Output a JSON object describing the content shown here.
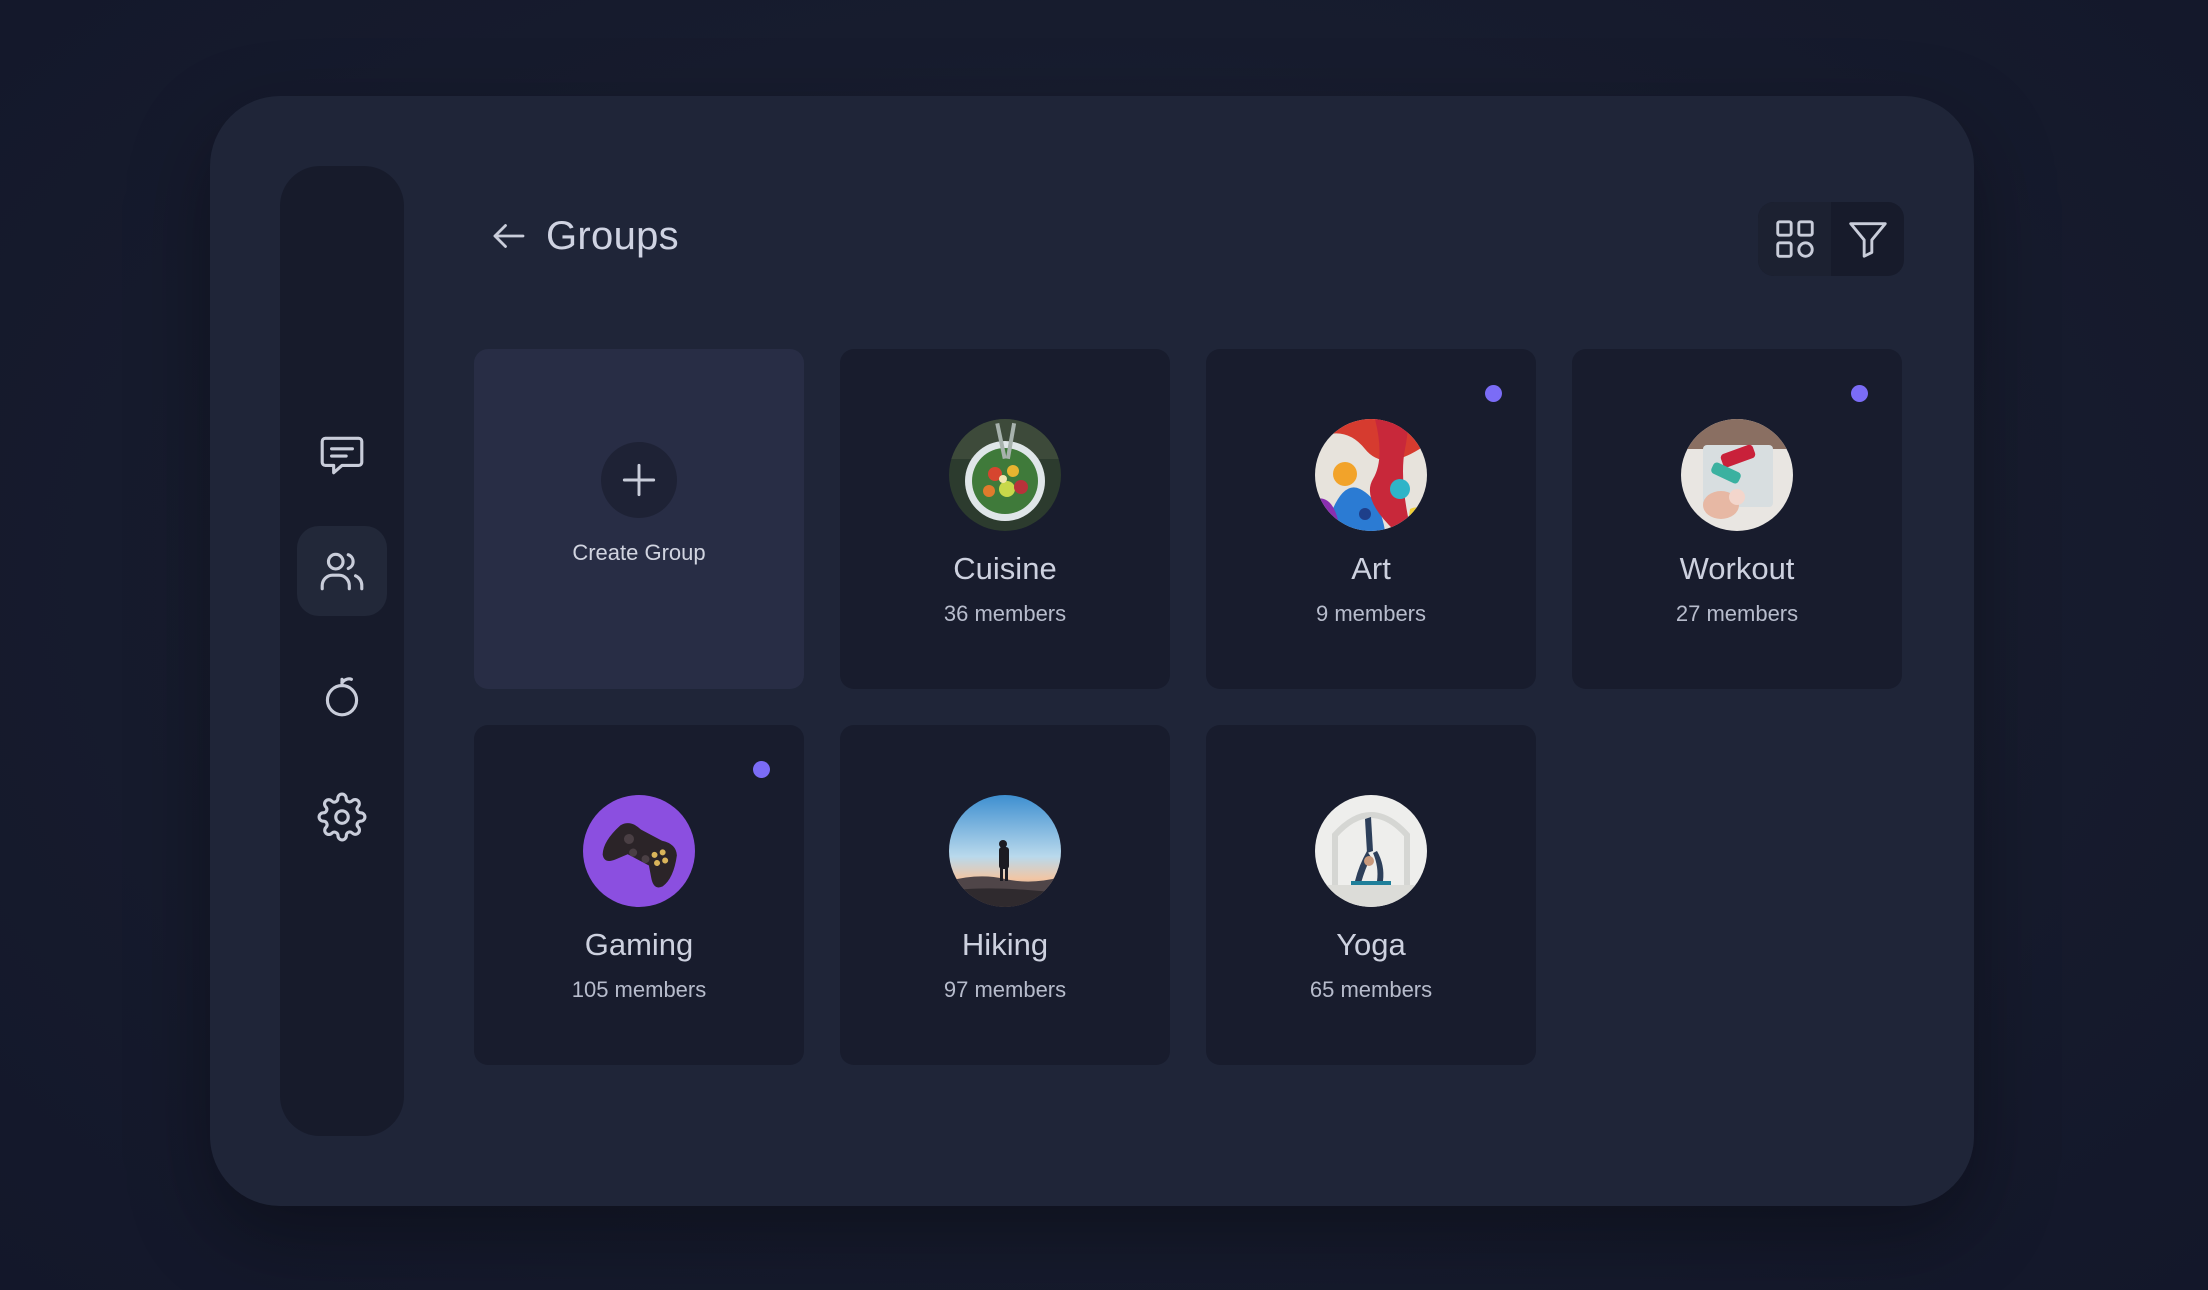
{
  "header": {
    "title": "Groups",
    "back_icon": "arrow-left-icon"
  },
  "toolbar": {
    "grid_view_icon": "grid-view-icon",
    "filter_icon": "filter-icon"
  },
  "sidebar": {
    "items": [
      {
        "icon": "chat-icon",
        "active": false
      },
      {
        "icon": "users-icon",
        "active": true
      },
      {
        "icon": "apple-icon",
        "active": false
      },
      {
        "icon": "gear-icon",
        "active": false
      }
    ]
  },
  "create": {
    "label": "Create Group",
    "icon": "plus-icon"
  },
  "groups": [
    {
      "name": "Cuisine",
      "members": "36 members",
      "unread": false
    },
    {
      "name": "Art",
      "members": "9 members",
      "unread": true
    },
    {
      "name": "Workout",
      "members": "27 members",
      "unread": true
    },
    {
      "name": "Gaming",
      "members": "105 members",
      "unread": true
    },
    {
      "name": "Hiking",
      "members": "97 members",
      "unread": false
    },
    {
      "name": "Yoga",
      "members": "65 members",
      "unread": false
    }
  ],
  "colors": {
    "accent_dot": "#7b6cf6",
    "window": "#1f2538",
    "card": "#181c2d",
    "create_card": "#282d45"
  }
}
